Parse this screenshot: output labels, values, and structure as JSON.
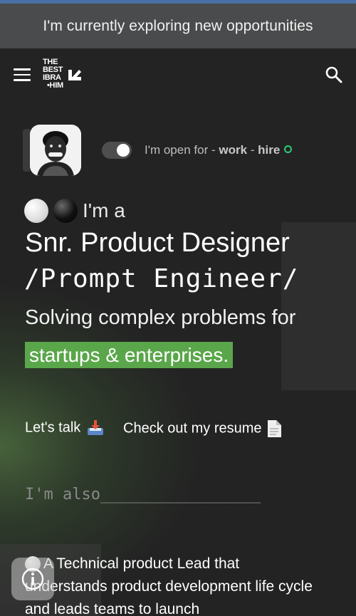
{
  "banner": {
    "text": "I'm currently exploring new opportunities"
  },
  "header": {
    "logo_lines": [
      "THE",
      "BEST",
      "IBRA",
      "•HIM"
    ],
    "menu_icon": "hamburger-icon",
    "search_icon": "search-icon"
  },
  "status": {
    "prefix": "I'm open for - ",
    "work": "work",
    "sep": " - ",
    "hire": "hire",
    "toggle_on": true
  },
  "hero": {
    "intro": "I'm a",
    "role": "Snr. Product Designer",
    "role2": "/Prompt Engineer/",
    "solving": "Solving complex problems for",
    "highlight": "startups & enterprises."
  },
  "ctas": {
    "talk": "Let's talk",
    "talk_icon": "inbox-tray-icon",
    "resume": "Check out my resume",
    "resume_icon": "document-icon"
  },
  "also": {
    "text": "I'm also_________________"
  },
  "bottom": {
    "text": "A Technical product Lead that understands product development life cycle and leads teams to launch"
  },
  "colors": {
    "accent_green": "#5aa64a",
    "banner_bg": "#4a4b4c",
    "status_dot": "#2ecc71"
  }
}
